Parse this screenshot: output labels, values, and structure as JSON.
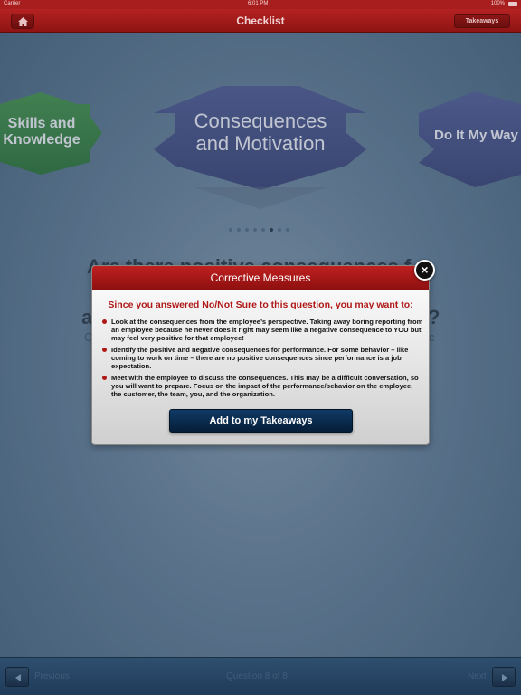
{
  "status_bar": {
    "carrier": "Carrier",
    "time": "6:01 PM",
    "battery": "100%"
  },
  "header": {
    "title": "Checklist",
    "takeaways_label": "Takeaways"
  },
  "carousel": {
    "items": [
      {
        "line1": "Skills and",
        "line2": "Knowledge",
        "color": "#2f7a3a"
      },
      {
        "line1": "Consequences",
        "line2": "and Motivation",
        "color": "#3c477e"
      },
      {
        "line1": "Do It My Way",
        "line2": "",
        "color": "#3c477e"
      }
    ],
    "page_count": 8,
    "active_page": 6
  },
  "background_question": {
    "line1": "Are there positive consequences f",
    "line2_start": "a",
    "line2_end": "?",
    "sub_start": "C",
    "sub_end": "c"
  },
  "modal": {
    "title": "Corrective Measures",
    "intro": "Since you answered No/Not Sure to this question, you may want to:",
    "bullets": [
      "Look at the consequences from the employee’s perspective.  Taking away boring reporting from an employee because he never does it right may seem like a negative consequence to YOU but may feel very positive for that employee!",
      "Identify the positive and negative consequences for performance.  For some behavior – like coming to work on time – there are no positive consequences since performance is a job expectation.",
      "Meet with the employee to discuss the consequences.  This may be a difficult conversation, so you will want to prepare.  Focus on the impact of the performance/behavior on the employee, the customer, the team, you, and the organization."
    ],
    "add_button": "Add to my Takeaways",
    "close_symbol": "×"
  },
  "toolbar": {
    "previous_label": "Previous",
    "question_label": "Question  8  of 8",
    "next_label": "Next"
  },
  "colors": {
    "nav_red": "#b52222",
    "accent_red": "#b01818",
    "button_navy": "#0f3a66"
  }
}
